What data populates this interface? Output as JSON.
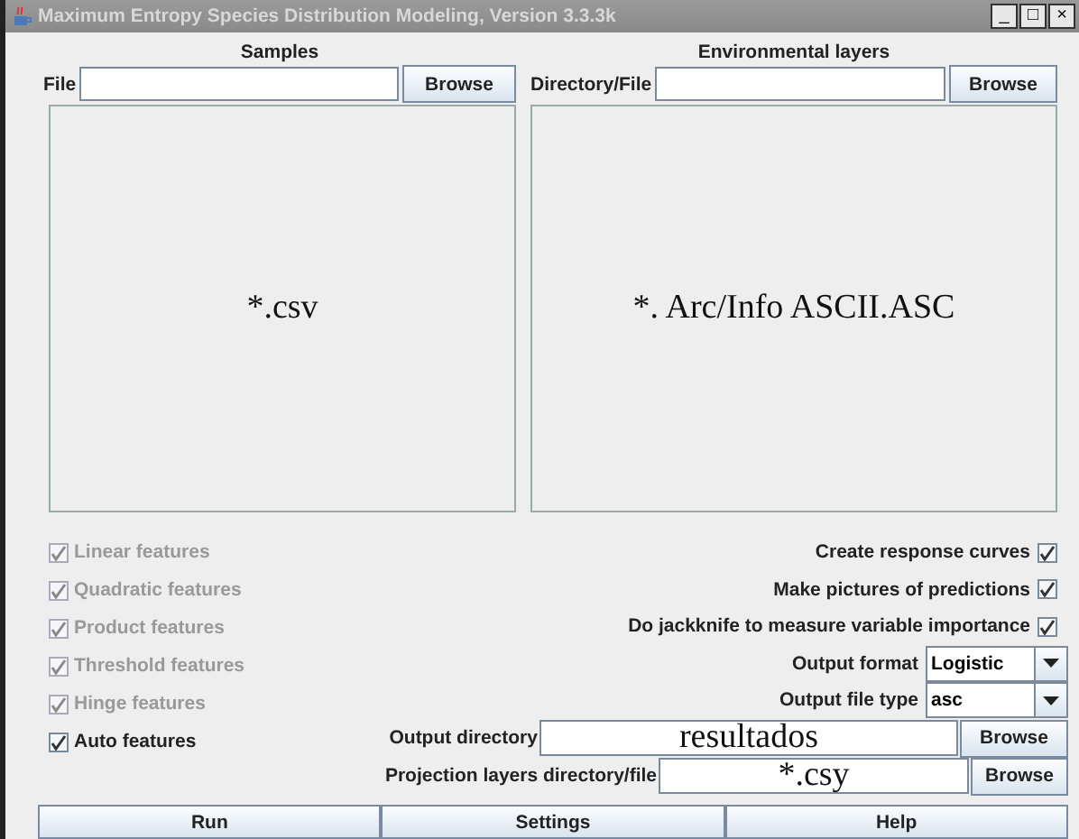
{
  "window": {
    "title": "Maximum Entropy Species Distribution Modeling, Version 3.3.3k",
    "controls": [
      "_",
      "□",
      "×"
    ]
  },
  "samples": {
    "heading": "Samples",
    "field_label": "File",
    "browse": "Browse",
    "list_text": "*.csv"
  },
  "environmental_layers": {
    "heading": "Environmental layers",
    "field_label": "Directory/File",
    "browse": "Browse",
    "list_text": "*. Arc/Info ASCII.ASC"
  },
  "features": [
    {
      "label": "Linear features",
      "checked": true,
      "disabled": true
    },
    {
      "label": "Quadratic features",
      "checked": true,
      "disabled": true
    },
    {
      "label": "Product features",
      "checked": true,
      "disabled": true
    },
    {
      "label": "Threshold features",
      "checked": true,
      "disabled": true
    },
    {
      "label": "Hinge features",
      "checked": true,
      "disabled": true
    },
    {
      "label": "Auto features",
      "checked": true,
      "disabled": false
    }
  ],
  "options": [
    {
      "label": "Create response curves",
      "checked": true
    },
    {
      "label": "Make pictures of predictions",
      "checked": true
    },
    {
      "label": "Do jackknife to measure variable importance",
      "checked": true
    }
  ],
  "output_format": {
    "label": "Output format",
    "value": "Logistic"
  },
  "output_file_type": {
    "label": "Output file type",
    "value": "asc"
  },
  "output_directory": {
    "label": "Output directory",
    "value": "resultados",
    "browse": "Browse"
  },
  "projection_layers": {
    "label": "Projection layers directory/file",
    "value": "*.csy",
    "browse": "Browse"
  },
  "buttons": [
    "Run",
    "Settings",
    "Help"
  ]
}
